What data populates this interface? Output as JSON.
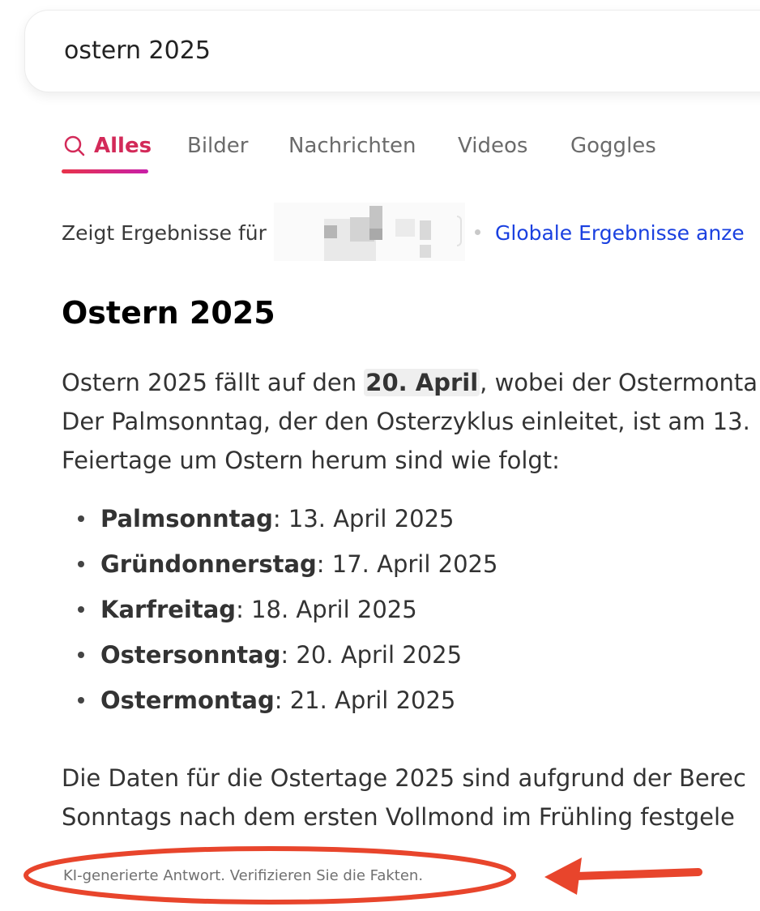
{
  "search": {
    "query": "ostern 2025"
  },
  "tabs": [
    {
      "label": "Alles",
      "active": true
    },
    {
      "label": "Bilder",
      "active": false
    },
    {
      "label": "Nachrichten",
      "active": false
    },
    {
      "label": "Videos",
      "active": false
    },
    {
      "label": "Goggles",
      "active": false
    }
  ],
  "region_bar": {
    "prefix": "Zeigt Ergebnisse für",
    "global_link": "Globale Ergebnisse anze"
  },
  "answer": {
    "title": "Ostern 2025",
    "para1": {
      "line1_before": "Ostern 2025 fällt auf den ",
      "line1_highlight": "20. April",
      "line1_after": ", wobei der Ostermonta",
      "line2": "Der Palmsonntag, der den Osterzyklus einleitet, ist am 13.",
      "line3": "Feiertage um Ostern herum sind wie folgt:"
    },
    "holidays": [
      {
        "term": "Palmsonntag",
        "date": ": 13. April 2025"
      },
      {
        "term": "Gründonnerstag",
        "date": ": 17. April 2025"
      },
      {
        "term": "Karfreitag",
        "date": ": 18. April 2025"
      },
      {
        "term": "Ostersonntag",
        "date": ": 20. April 2025"
      },
      {
        "term": "Ostermontag",
        "date": ": 21. April 2025"
      }
    ],
    "para2": {
      "line1": "Die Daten für die Ostertage 2025 sind aufgrund der Berec",
      "line2": "Sonntags nach dem ersten Vollmond im Frühling festgele"
    },
    "disclaimer": "KI-generierte Antwort. Verifizieren Sie die Fakten."
  },
  "colors": {
    "accent": "#d32a59",
    "link": "#1a40e0",
    "annotation": "#e8452c"
  },
  "icons": {
    "tab_alles": "search-icon"
  }
}
